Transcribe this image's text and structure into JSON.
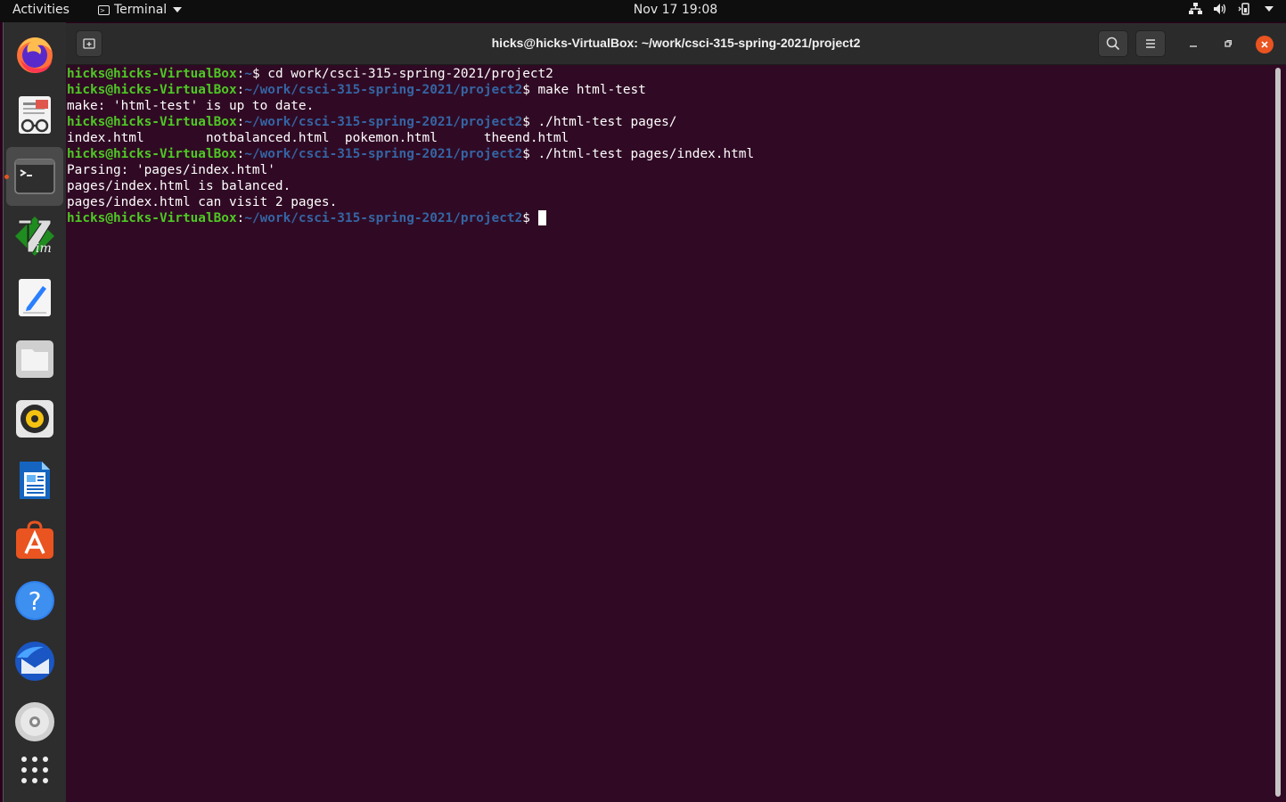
{
  "topbar": {
    "activities": "Activities",
    "app_name": "Terminal",
    "clock": "Nov 17  19:08"
  },
  "dock": {
    "items": [
      {
        "name": "firefox"
      },
      {
        "name": "libreoffice-impress"
      },
      {
        "name": "terminal",
        "active": true
      },
      {
        "name": "vim"
      },
      {
        "name": "text-editor"
      },
      {
        "name": "files"
      },
      {
        "name": "rhythmbox"
      },
      {
        "name": "libreoffice-writer"
      },
      {
        "name": "ubuntu-software"
      },
      {
        "name": "help"
      },
      {
        "name": "thunderbird"
      },
      {
        "name": "disc"
      },
      {
        "name": "show-applications"
      }
    ]
  },
  "window": {
    "title": "hicks@hicks-VirtualBox: ~/work/csci-315-spring-2021/project2"
  },
  "terminal": {
    "lines": [
      {
        "type": "prompt",
        "user": "hicks@hicks-VirtualBox",
        "sep": ":",
        "path": "~",
        "cmd": "$ cd work/csci-315-spring-2021/project2"
      },
      {
        "type": "prompt",
        "user": "hicks@hicks-VirtualBox",
        "sep": ":",
        "path": "~/work/csci-315-spring-2021/project2",
        "cmd": "$ make html-test"
      },
      {
        "type": "output",
        "text": "make: 'html-test' is up to date."
      },
      {
        "type": "prompt",
        "user": "hicks@hicks-VirtualBox",
        "sep": ":",
        "path": "~/work/csci-315-spring-2021/project2",
        "cmd": "$ ./html-test pages/"
      },
      {
        "type": "output",
        "text": "index.html        notbalanced.html  pokemon.html      theend.html"
      },
      {
        "type": "prompt",
        "user": "hicks@hicks-VirtualBox",
        "sep": ":",
        "path": "~/work/csci-315-spring-2021/project2",
        "cmd": "$ ./html-test pages/index.html"
      },
      {
        "type": "output",
        "text": "Parsing: 'pages/index.html'"
      },
      {
        "type": "output",
        "text": "pages/index.html is balanced."
      },
      {
        "type": "output",
        "text": "pages/index.html can visit 2 pages."
      },
      {
        "type": "prompt",
        "user": "hicks@hicks-VirtualBox",
        "sep": ":",
        "path": "~/work/csci-315-spring-2021/project2",
        "cmd": "$ ",
        "cursor": true
      }
    ]
  },
  "colors": {
    "terminal_bg": "#300a24",
    "prompt_user": "#4ec924",
    "prompt_path": "#3465a4",
    "accent": "#e95420"
  }
}
